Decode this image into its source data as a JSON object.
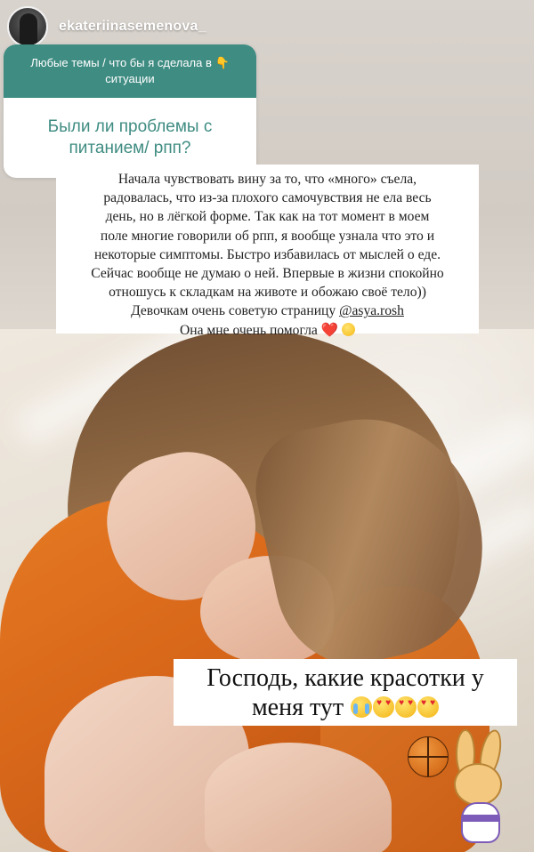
{
  "header": {
    "username": "ekateriinasemenova_"
  },
  "question_sticker": {
    "prompt": "Любые темы / что бы я сделала в 👇 ситуации",
    "question": "Были ли проблемы с питанием/ рпп?"
  },
  "answer": {
    "lines": [
      "Начала чувствовать вину за то, что «много» съела,",
      "радовалась, что из-за плохого самочувствия не ела весь",
      "день, но в лёгкой форме. Так как на тот момент в моем",
      "поле многие говорили об рпп, я вообще узнала что это и",
      "некоторые симптомы. Быстро избавилась от мыслей о еде.",
      "Сейчас вообще не думаю о ней. Впервые в жизни спокойно",
      "отношусь к складкам на животе и обожаю своё тело))"
    ],
    "recommend_prefix": "Девочкам очень советую страницу ",
    "mention": "@asya.rosh",
    "last_line": "Она мне очень помогла ",
    "heart": "❤️"
  },
  "caption": {
    "line1": "Господь, какие красотки у",
    "line2": "меня тут "
  },
  "stickers": {
    "left": "basketball-sticker",
    "right": "lola-bunny-sticker"
  },
  "colors": {
    "question_teal": "#3f8c82",
    "sweater_orange": "#e57a23"
  }
}
